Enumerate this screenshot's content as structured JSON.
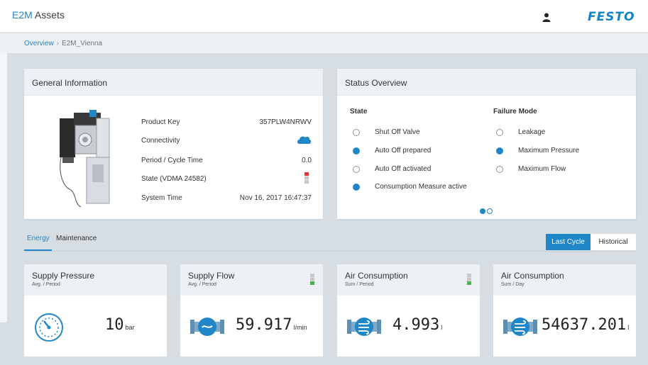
{
  "header": {
    "brand_prefix": "E2M",
    "brand_suffix": " Assets",
    "logo": "FESTO",
    "user_icon": "user-icon",
    "accent_color": "#1f86c8"
  },
  "breadcrumb": {
    "items": [
      "Overview",
      "E2M_Vienna"
    ],
    "separator": "›"
  },
  "general_info": {
    "title": "General Information",
    "rows": [
      {
        "label": "Product Key",
        "value": "357PLW4NRWV"
      },
      {
        "label": "Connectivity",
        "value": "",
        "icon": "cloud-icon"
      },
      {
        "label": "Period / Cycle Time",
        "value": "0.0"
      },
      {
        "label": "State (VDMA 24582)",
        "value": "",
        "icon": "state-indicator-icon"
      },
      {
        "label": "System Time",
        "value": "Nov 16, 2017 16:47:37"
      }
    ]
  },
  "status_overview": {
    "title": "Status Overview",
    "state_title": "State",
    "failure_title": "Failure Mode",
    "state_items": [
      {
        "label": "Shut Off Valve",
        "active": false
      },
      {
        "label": "Auto Off prepared",
        "active": true
      },
      {
        "label": "Auto Off activated",
        "active": false
      },
      {
        "label": "Consumption Measure active",
        "active": true
      }
    ],
    "failure_items": [
      {
        "label": "Leakage",
        "active": false
      },
      {
        "label": "Maximum Pressure",
        "active": true
      },
      {
        "label": "Maximum Flow",
        "active": false
      }
    ]
  },
  "tabs": [
    {
      "label": "Energy",
      "active": true
    },
    {
      "label": "Maintenance",
      "active": false
    }
  ],
  "toggle": {
    "last_cycle": "Last Cycle",
    "historical": "Historical"
  },
  "metrics": [
    {
      "title": "Supply Pressure",
      "subtitle": "Avg. / Period",
      "value": "10",
      "unit": "bar",
      "icon": "gauge-icon"
    },
    {
      "title": "Supply Flow",
      "subtitle": "Avg. / Period",
      "value": "59.917",
      "unit": "l/min",
      "icon": "flow-icon"
    },
    {
      "title": "Air Consumption",
      "subtitle": "Sum / Period",
      "value": "4.993",
      "unit": "l",
      "icon": "air-consumption-icon"
    },
    {
      "title": "Air Consumption",
      "subtitle": "Sum / Day",
      "value": "54637.201",
      "unit": "l",
      "icon": "air-consumption-icon"
    }
  ]
}
